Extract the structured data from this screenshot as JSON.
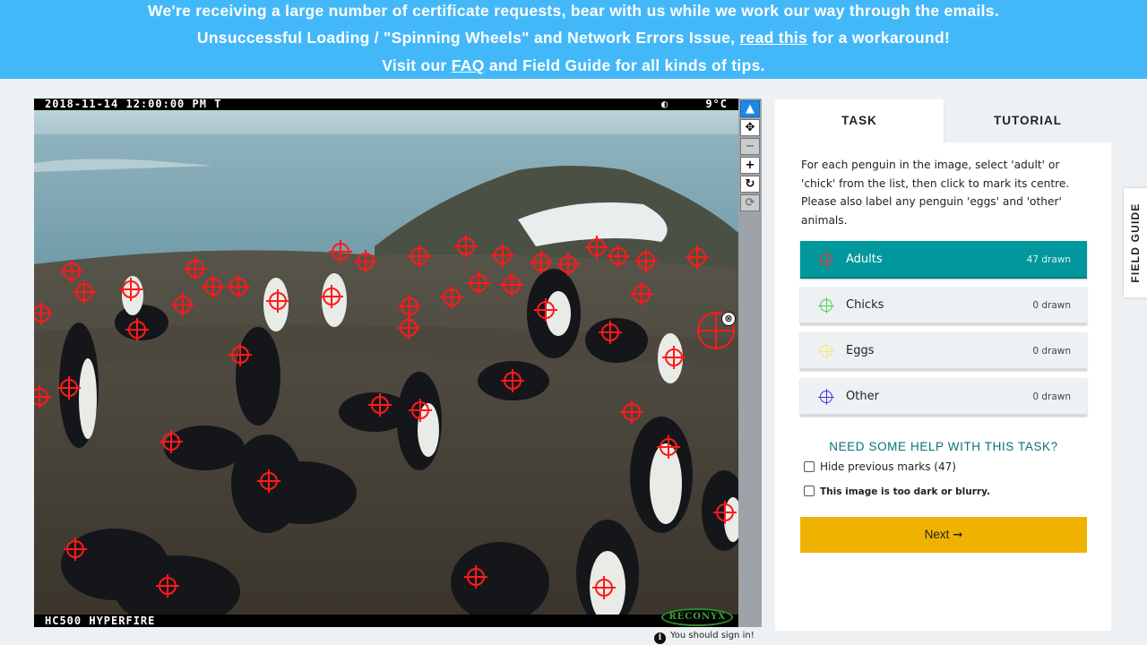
{
  "banner": {
    "line1": "We're receiving a large number of certificate requests, bear with us while we work our way through the emails.",
    "line2_pre": "Unsuccessful Loading / \"Spinning Wheels\" and Network Errors Issue, ",
    "line2_link": "read this",
    "line2_post": " for a workaround!",
    "line3_pre": "Visit our ",
    "line3_link": "FAQ",
    "line3_post": " and Field Guide for all kinds of tips.",
    "color": "#43b8f9"
  },
  "subject": {
    "timestamp": "2018-11-14 12:00:00 PM  T",
    "moon": "◐",
    "temperature": "9°C",
    "model": "HC500 HYPERFIRE",
    "brand": "RECONYX",
    "mark_color": "#ff1a1a",
    "remove_icon": "⊗"
  },
  "tools": [
    {
      "name": "pointer-tool",
      "icon": "pointer-arrow-icon",
      "glyph": "▲",
      "state": "active"
    },
    {
      "name": "move-tool",
      "icon": "move-arrows-icon",
      "glyph": "✥",
      "state": "normal"
    },
    {
      "name": "zoom-out-tool",
      "icon": "minus-icon",
      "glyph": "−",
      "state": "disabled"
    },
    {
      "name": "zoom-in-tool",
      "icon": "plus-icon",
      "glyph": "+",
      "state": "normal"
    },
    {
      "name": "rotate-tool",
      "icon": "rotate-icon",
      "glyph": "↻",
      "state": "normal"
    },
    {
      "name": "reset-tool",
      "icon": "refresh-icon",
      "glyph": "⟳",
      "state": "disabled"
    }
  ],
  "signin": "You should sign in!",
  "panel": {
    "tabs": [
      "TASK",
      "TUTORIAL"
    ],
    "instructions": "For each penguin in the image, select 'adult' or 'chick' from the list, then click to mark its centre. Please also label any penguin 'eggs' and 'other' animals.",
    "choices": [
      {
        "label": "Adults",
        "count": "47 drawn",
        "icon_color": "#e53935",
        "active": true
      },
      {
        "label": "Chicks",
        "count": "0 drawn",
        "icon_color": "#4cd04c",
        "active": false
      },
      {
        "label": "Eggs",
        "count": "0 drawn",
        "icon_color": "#f2ea6b",
        "active": false
      },
      {
        "label": "Other",
        "count": "0 drawn",
        "icon_color": "#3a3ad9",
        "active": false
      }
    ],
    "help": "NEED SOME HELP WITH THIS TASK?",
    "hide_marks": "Hide previous marks (47)",
    "too_dark": "This image is too dark or blurry.",
    "next": "Next ➞",
    "accent": "#00979d",
    "next_color": "#f0b200"
  },
  "field_guide": "FIELD GUIDE"
}
